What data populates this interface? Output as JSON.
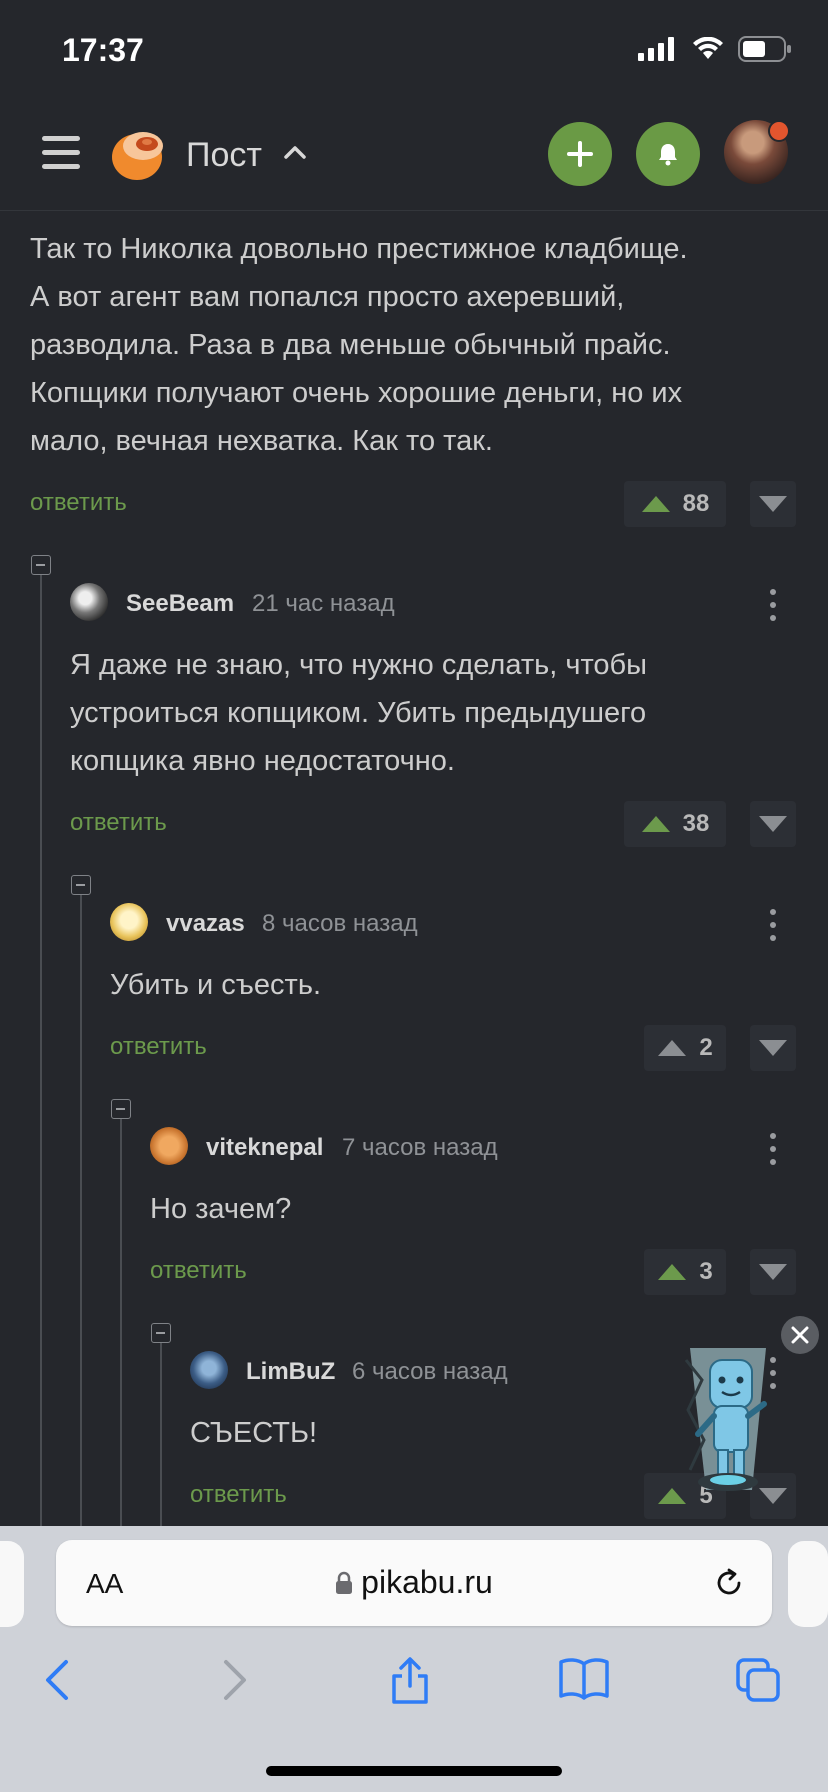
{
  "status_bar": {
    "time": "17:37"
  },
  "header": {
    "title": "Пост"
  },
  "post": {
    "lines": [
      "Так то Николка довольно престижное кладбище.",
      "А вот агент вам попался просто ахеревший,",
      "разводила. Раза в два меньше обычный прайс.",
      "Копщики получают очень хорошие деньги, но их",
      "мало, вечная нехватка. Как то так."
    ],
    "reply_label": "ответить",
    "rating": "88"
  },
  "comments": [
    {
      "author": "SeeBeam",
      "time": "21 час назад",
      "lines": [
        "Я даже не знаю, что нужно сделать, чтобы",
        "устроиться копщиком. Убить предыдушего",
        "копщика явно недостаточно."
      ],
      "reply_label": "ответить",
      "rating": "38"
    },
    {
      "author": "vvazas",
      "time": "8 часов назад",
      "lines": [
        "Убить и съесть."
      ],
      "reply_label": "ответить",
      "rating": "2"
    },
    {
      "author": "viteknepal",
      "time": "7 часов назад",
      "lines": [
        "Но зачем?"
      ],
      "reply_label": "ответить",
      "rating": "3"
    },
    {
      "author": "LimBuZ",
      "time": "6 часов назад",
      "lines": [
        "СЪЕСТЬ!"
      ],
      "reply_label": "ответить",
      "rating": "5"
    }
  ],
  "browser": {
    "text_size_label": "AA",
    "domain": "pikabu.ru"
  },
  "colors": {
    "background": "#25272c",
    "accent_green": "#6a9a45",
    "link_green": "#6c9a4c",
    "notification_dot": "#e2552e",
    "ios_blue": "#2f7cf6"
  }
}
